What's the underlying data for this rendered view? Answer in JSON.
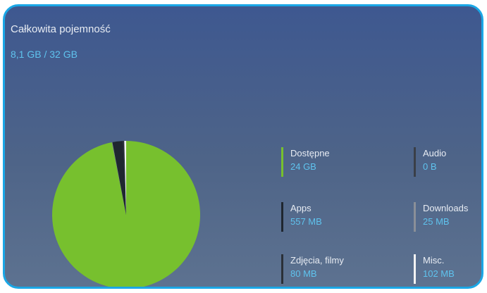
{
  "storage": {
    "title": "Całkowita pojemność",
    "usage": "8,1 GB / 32 GB"
  },
  "legend": [
    {
      "label": "Dostępne",
      "value": "24 GB",
      "color": "#77c02e"
    },
    {
      "label": "Audio",
      "value": "0 B",
      "color": "#3a3f48"
    },
    {
      "label": "Apps",
      "value": "557 MB",
      "color": "#1f2630"
    },
    {
      "label": "Downloads",
      "value": "25 MB",
      "color": "#8a8f98"
    },
    {
      "label": "Zdjęcia, filmy",
      "value": "80 MB",
      "color": "#2b3038"
    },
    {
      "label": "Misc.",
      "value": "102 MB",
      "color": "#f2f2f2"
    }
  ],
  "chart_data": {
    "type": "pie",
    "slices": [
      {
        "label": "Dostępne",
        "value": 24000,
        "color": "#77c02e"
      },
      {
        "label": "Audio",
        "value": 0,
        "color": "#3a3f48"
      },
      {
        "label": "Apps",
        "value": 557,
        "color": "#1f2630"
      },
      {
        "label": "Downloads",
        "value": 25,
        "color": "#8a8f98"
      },
      {
        "label": "Zdjęcia, filmy",
        "value": 80,
        "color": "#2b3038"
      },
      {
        "label": "Misc.",
        "value": 102,
        "color": "#f2f2f2"
      }
    ]
  }
}
